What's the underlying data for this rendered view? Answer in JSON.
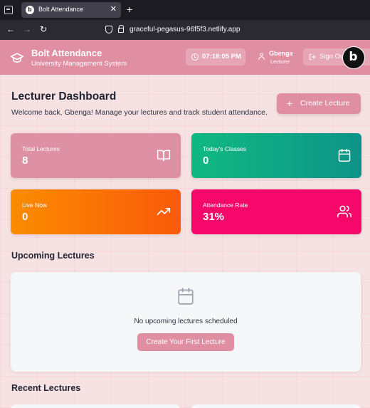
{
  "browser": {
    "tab_title": "Bolt Attendance",
    "tab_favicon": "b",
    "tab_close": "✕",
    "new_tab": "+",
    "back": "←",
    "forward": "→",
    "reload": "↻",
    "url": "graceful-pegasus-96f5f3.netlify.app"
  },
  "header": {
    "title": "Bolt Attendance",
    "subtitle": "University Management System",
    "time": "07:18:05 PM",
    "user_name": "Gbenga",
    "user_role": "Lecturer",
    "signout_label": "Sign Out",
    "badge_letter": "b"
  },
  "dashboard": {
    "title": "Lecturer Dashboard",
    "welcome": "Welcome back, Gbenga! Manage your lectures and track student attendance.",
    "create_button": "Create Lecture",
    "create_icon": "+"
  },
  "stats": [
    {
      "label": "Total Lectures",
      "value": "8",
      "icon": "book-icon",
      "color": "#de90a5"
    },
    {
      "label": "Today's Classes",
      "value": "0",
      "icon": "calendar-icon",
      "color": "#10b981"
    },
    {
      "label": "Live Now",
      "value": "0",
      "icon": "trending-up-icon",
      "color": "#fb8c00"
    },
    {
      "label": "Attendance Rate",
      "value": "31%",
      "icon": "users-icon",
      "color": "#f5086a"
    }
  ],
  "upcoming": {
    "title": "Upcoming Lectures",
    "empty_text": "No upcoming lectures scheduled",
    "button": "Create Your First Lecture"
  },
  "recent": {
    "title": "Recent Lectures"
  }
}
